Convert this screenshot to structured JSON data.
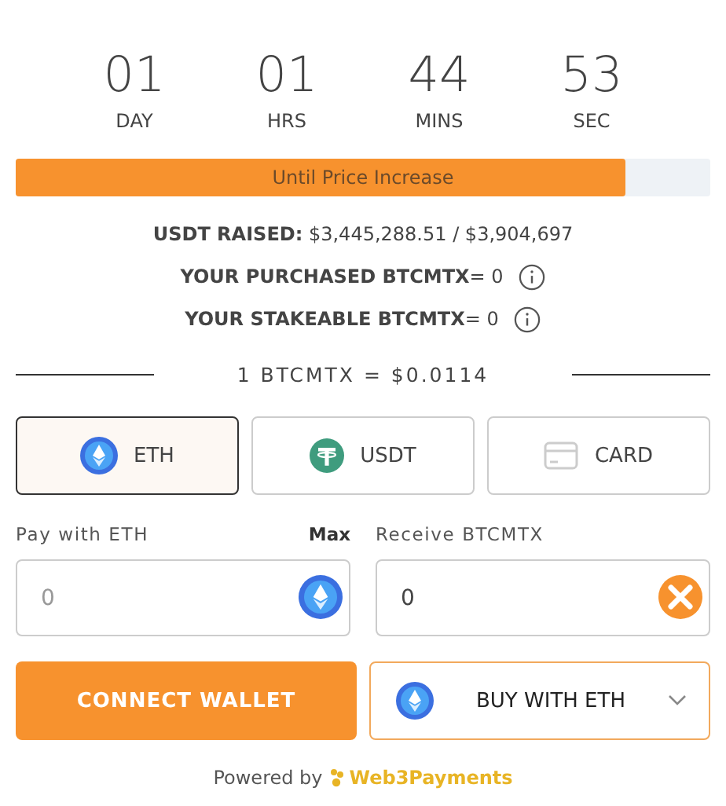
{
  "countdown": [
    {
      "value": "01",
      "unit": "DAY"
    },
    {
      "value": "01",
      "unit": "HRS"
    },
    {
      "value": "44",
      "unit": "MINS"
    },
    {
      "value": "53",
      "unit": "SEC"
    }
  ],
  "progress": {
    "label": "Until Price Increase",
    "level": 0.878
  },
  "stats": [
    {
      "text": "**USDT RAISED:** $3,445,288.51 / $3,904,697",
      "info": false
    },
    {
      "text": "**YOUR PURCHASED BTCMTX**= 0",
      "info": true
    },
    {
      "text": "**YOUR STAKEABLE BTCMTX**= 0",
      "info": true
    }
  ],
  "price": "1 BTCMTX = $0.0114",
  "methods": [
    {
      "kind": "eth",
      "label": "ETH",
      "selected": true
    },
    {
      "kind": "usdt",
      "label": "USDT",
      "selected": false
    },
    {
      "kind": "card",
      "label": "CARD",
      "selected": false
    }
  ],
  "pay": {
    "label": "Pay with ETH",
    "max": "Max",
    "placeholder": "0"
  },
  "receive": {
    "label": "Receive BTCMTX",
    "value": "0"
  },
  "connect_button": "CONNECT WALLET",
  "buy_select": {
    "label": "BUY WITH ETH"
  },
  "footer": {
    "prefix": "Powered by",
    "brand": "Web3Payments"
  }
}
